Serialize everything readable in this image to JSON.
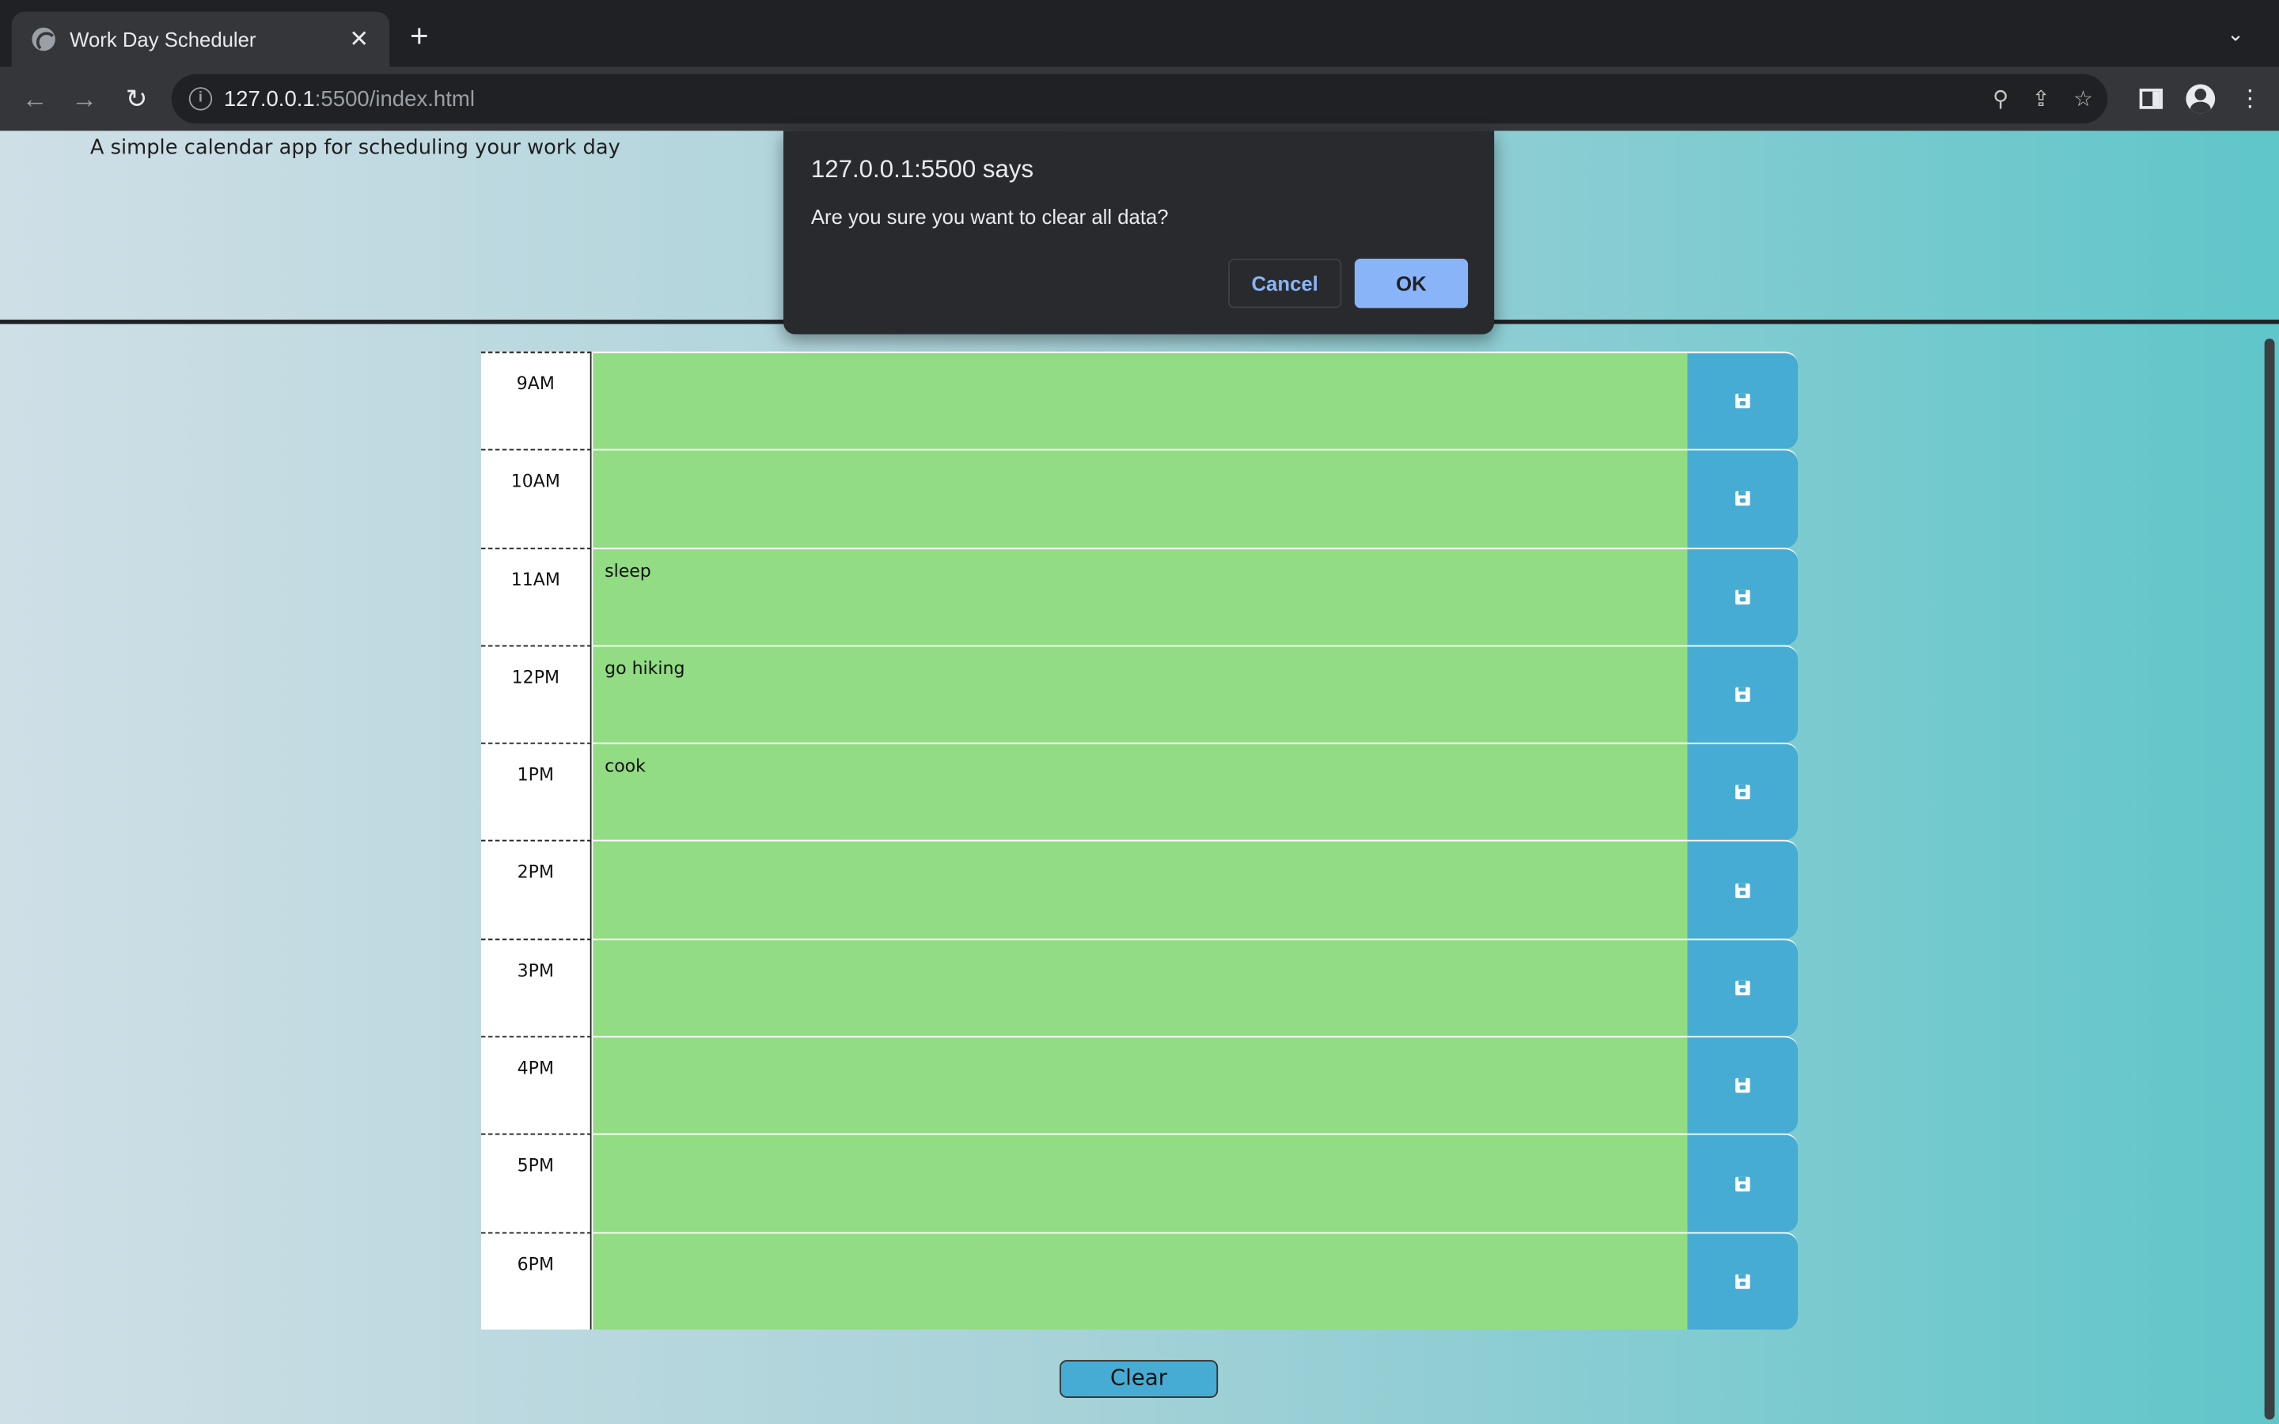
{
  "browser": {
    "tab_title": "Work Day Scheduler",
    "new_tab_symbol": "+",
    "close_symbol": "✕",
    "tab_menu_symbol": "⌄",
    "url_host": "127.0.0.1",
    "url_path": ":5500/index.html"
  },
  "page": {
    "lead": "A simple calendar app for scheduling your work day",
    "clear_label": "Clear"
  },
  "schedule": [
    {
      "hour": "9AM",
      "text": ""
    },
    {
      "hour": "10AM",
      "text": ""
    },
    {
      "hour": "11AM",
      "text": "sleep"
    },
    {
      "hour": "12PM",
      "text": "go hiking"
    },
    {
      "hour": "1PM",
      "text": "cook"
    },
    {
      "hour": "2PM",
      "text": ""
    },
    {
      "hour": "3PM",
      "text": ""
    },
    {
      "hour": "4PM",
      "text": ""
    },
    {
      "hour": "5PM",
      "text": ""
    },
    {
      "hour": "6PM",
      "text": ""
    }
  ],
  "dialog": {
    "title": "127.0.0.1:5500 says",
    "message": "Are you sure you want to clear all data?",
    "cancel_label": "Cancel",
    "ok_label": "OK"
  },
  "colors": {
    "row_present": "#92dc83",
    "save_button": "#47acd3",
    "dialog_ok": "#8ab4f8"
  },
  "icons": {
    "save": "floppy-disk-icon",
    "back": "arrow-left-icon",
    "forward": "arrow-right-icon",
    "reload": "reload-icon"
  }
}
